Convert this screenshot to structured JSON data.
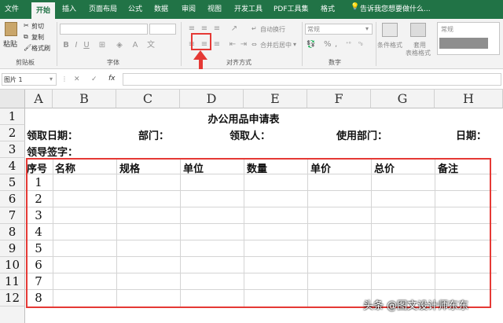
{
  "ribbon_tabs": [
    "文件",
    "开始",
    "插入",
    "页面布局",
    "公式",
    "数据",
    "审阅",
    "视图",
    "开发工具",
    "PDF工具集",
    "格式"
  ],
  "tell_me": "告诉我您想要做什么...",
  "clipboard": {
    "paste": "粘贴",
    "cut": "剪切",
    "copy": "复制",
    "format_painter": "格式刷",
    "label": "剪贴板"
  },
  "font_group": {
    "label": "字体"
  },
  "alignment": {
    "wrap_text": "自动换行",
    "merge_center": "合并后居中",
    "label": "对齐方式"
  },
  "number": {
    "format": "常规",
    "percent": "%",
    "comma": ",",
    "label": "数字"
  },
  "styles": {
    "conditional": "条件格式",
    "table_format_1": "套用",
    "table_format_2": "表格格式",
    "normal": "常规"
  },
  "formula_bar": {
    "name_box": "图片 1",
    "cancel": "✕",
    "enter": "✓",
    "fx": "fx"
  },
  "columns": [
    "A",
    "B",
    "C",
    "D",
    "E",
    "F",
    "G",
    "H"
  ],
  "rows": [
    "1",
    "2",
    "3",
    "4",
    "5",
    "6",
    "7",
    "8",
    "9",
    "10",
    "11",
    "12"
  ],
  "sheet": {
    "title": "办公用品申请表",
    "row2": {
      "collect_date": "领取日期：",
      "dept": "部门：",
      "receiver": "领取人：",
      "use_dept": "使用部门：",
      "date": "日期："
    },
    "row3": {
      "leader_sign": "领导签字："
    },
    "headers": [
      "序号",
      "名称",
      "规格",
      "单位",
      "数量",
      "单价",
      "总价",
      "备注"
    ],
    "serials": [
      "1",
      "2",
      "3",
      "4",
      "5",
      "6",
      "7",
      "8"
    ]
  },
  "watermark": "头条 @图文设计师东东",
  "colors": {
    "excel_green": "#217346",
    "highlight_red": "#e53935"
  }
}
